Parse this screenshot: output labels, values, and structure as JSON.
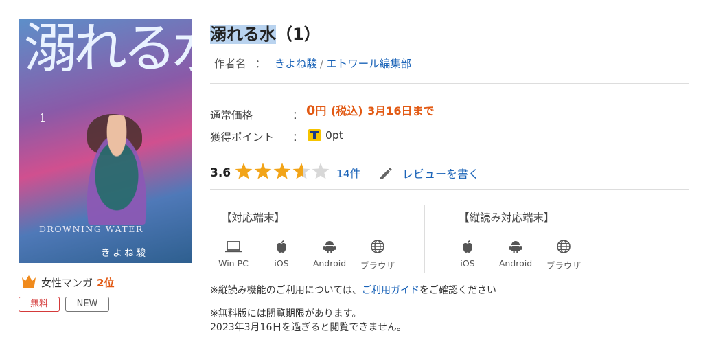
{
  "cover": {
    "title_art": "溺れる水",
    "volume_mark": "1",
    "english_title": "DROWNING WATER",
    "author_art": "きよね駿"
  },
  "ranking": {
    "category": "女性マンガ",
    "rank": "2位"
  },
  "badges": {
    "free": "無料",
    "new": "NEW"
  },
  "product": {
    "title_highlight": "溺れる水",
    "title_rest": "（1）",
    "author_label": "作者名",
    "author_colon": "：",
    "author_name": "きよね駿",
    "author_sep": "/",
    "publisher": "エトワール編集部"
  },
  "price": {
    "label": "通常価格",
    "colon": "：",
    "amount": "0",
    "yen": "円",
    "tax": "(税込)",
    "until": "3月16日まで"
  },
  "points": {
    "label": "獲得ポイント",
    "colon": "：",
    "value": "0pt"
  },
  "rating": {
    "score": "3.6",
    "stars_value": 3.6,
    "review_count": "14件",
    "write_review": "レビューを書く"
  },
  "devices": {
    "title": "【対応端末】",
    "items": [
      "Win PC",
      "iOS",
      "Android",
      "ブラウザ"
    ]
  },
  "vertical_devices": {
    "title": "【縦読み対応端末】",
    "items": [
      "iOS",
      "Android",
      "ブラウザ"
    ]
  },
  "notes": {
    "vertical_prefix": "※縦読み機能のご利用については、",
    "guide_link": "ご利用ガイド",
    "vertical_suffix": "をご確認ください",
    "free_line1": "※無料版には閲覧期限があります。",
    "free_line2": "2023年3月16日を過ぎると閲覧できません。"
  },
  "colors": {
    "accent": "#e25a14",
    "link": "#1a63b8",
    "star": "#f2a418",
    "star_empty": "#d8d8d8",
    "highlight": "#b9d3ef"
  }
}
